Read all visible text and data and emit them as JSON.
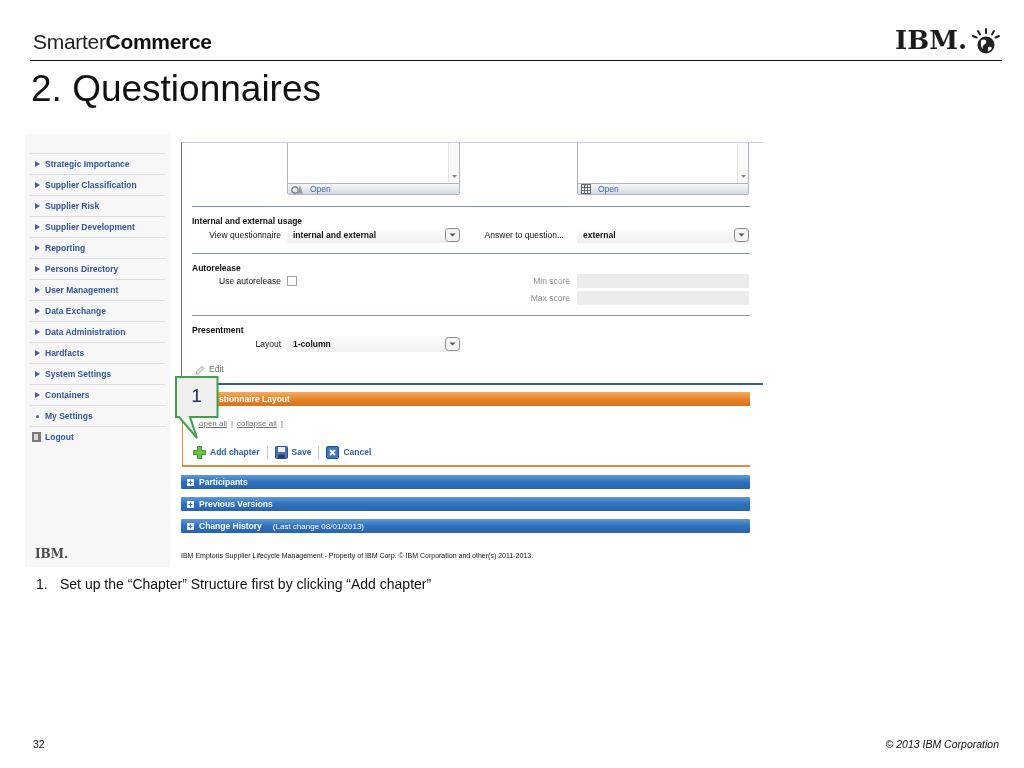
{
  "header": {
    "brand": "Smarter**Commerce**",
    "logo": "IBM."
  },
  "title": "2. Questionnaires",
  "app": {
    "sidebar": {
      "items": [
        {
          "label": "Strategic Importance",
          "kind": "arrow"
        },
        {
          "label": "Supplier Classification",
          "kind": "arrow"
        },
        {
          "label": "Supplier Risk",
          "kind": "arrow"
        },
        {
          "label": "Supplier Development",
          "kind": "arrow"
        },
        {
          "label": "Reporting",
          "kind": "arrow"
        },
        {
          "label": "Persons Directory",
          "kind": "arrow"
        },
        {
          "label": "User Management",
          "kind": "arrow"
        },
        {
          "label": "Data Exchange",
          "kind": "arrow"
        },
        {
          "label": "Data Administration",
          "kind": "arrow"
        },
        {
          "label": "Hardfacts",
          "kind": "arrow"
        },
        {
          "label": "System Settings",
          "kind": "arrow"
        },
        {
          "label": "Containers",
          "kind": "arrow"
        },
        {
          "label": "My Settings",
          "kind": "bullet"
        },
        {
          "label": "Logout",
          "kind": "logout"
        }
      ],
      "logo": "IBM."
    },
    "attachments": [
      {
        "kind": "shapes",
        "button": "Open"
      },
      {
        "kind": "grid",
        "button": "Open"
      }
    ],
    "usage": {
      "heading": "Internal and external usage",
      "fields": [
        {
          "label": "View questionnaire",
          "value": "internal and external"
        },
        {
          "label": "Answer to question...",
          "value": "external"
        }
      ]
    },
    "autorelease": {
      "heading": "Autorelease",
      "checkbox": {
        "label": "Use autorelease",
        "checked": false
      },
      "scores": [
        {
          "label": "Min score",
          "disabled": true
        },
        {
          "label": "Max score",
          "disabled": true
        }
      ]
    },
    "presentment": {
      "heading": "Presentment",
      "fields": [
        {
          "label": "Layout",
          "value": "1-column"
        }
      ]
    },
    "edit": "Edit",
    "layout_panel": {
      "title": "stionnaire Layout",
      "links": [
        "open all",
        "collapse all"
      ],
      "separator": "|",
      "bracket": "]",
      "actions": [
        {
          "kind": "add",
          "label": "Add chapter"
        },
        {
          "kind": "save",
          "label": "Save"
        },
        {
          "kind": "cancel",
          "label": "Cancel"
        }
      ]
    },
    "panels": [
      {
        "title": "Participants"
      },
      {
        "title": "Previous Versions"
      },
      {
        "title": "Change History",
        "note": "(Last change 08/01/2013)"
      }
    ],
    "footer": "IBM Emptoris Supplier Lifecycle Management - Property of IBM Corp. © IBM Corporation and other(s) 2011-2013."
  },
  "callout": {
    "number": "1"
  },
  "note": {
    "number": "1.",
    "text": "Set up the “Chapter” Structure first by clicking “Add chapter”"
  },
  "footer": {
    "page": "32",
    "copyright": "© 2013 IBM Corporation"
  }
}
